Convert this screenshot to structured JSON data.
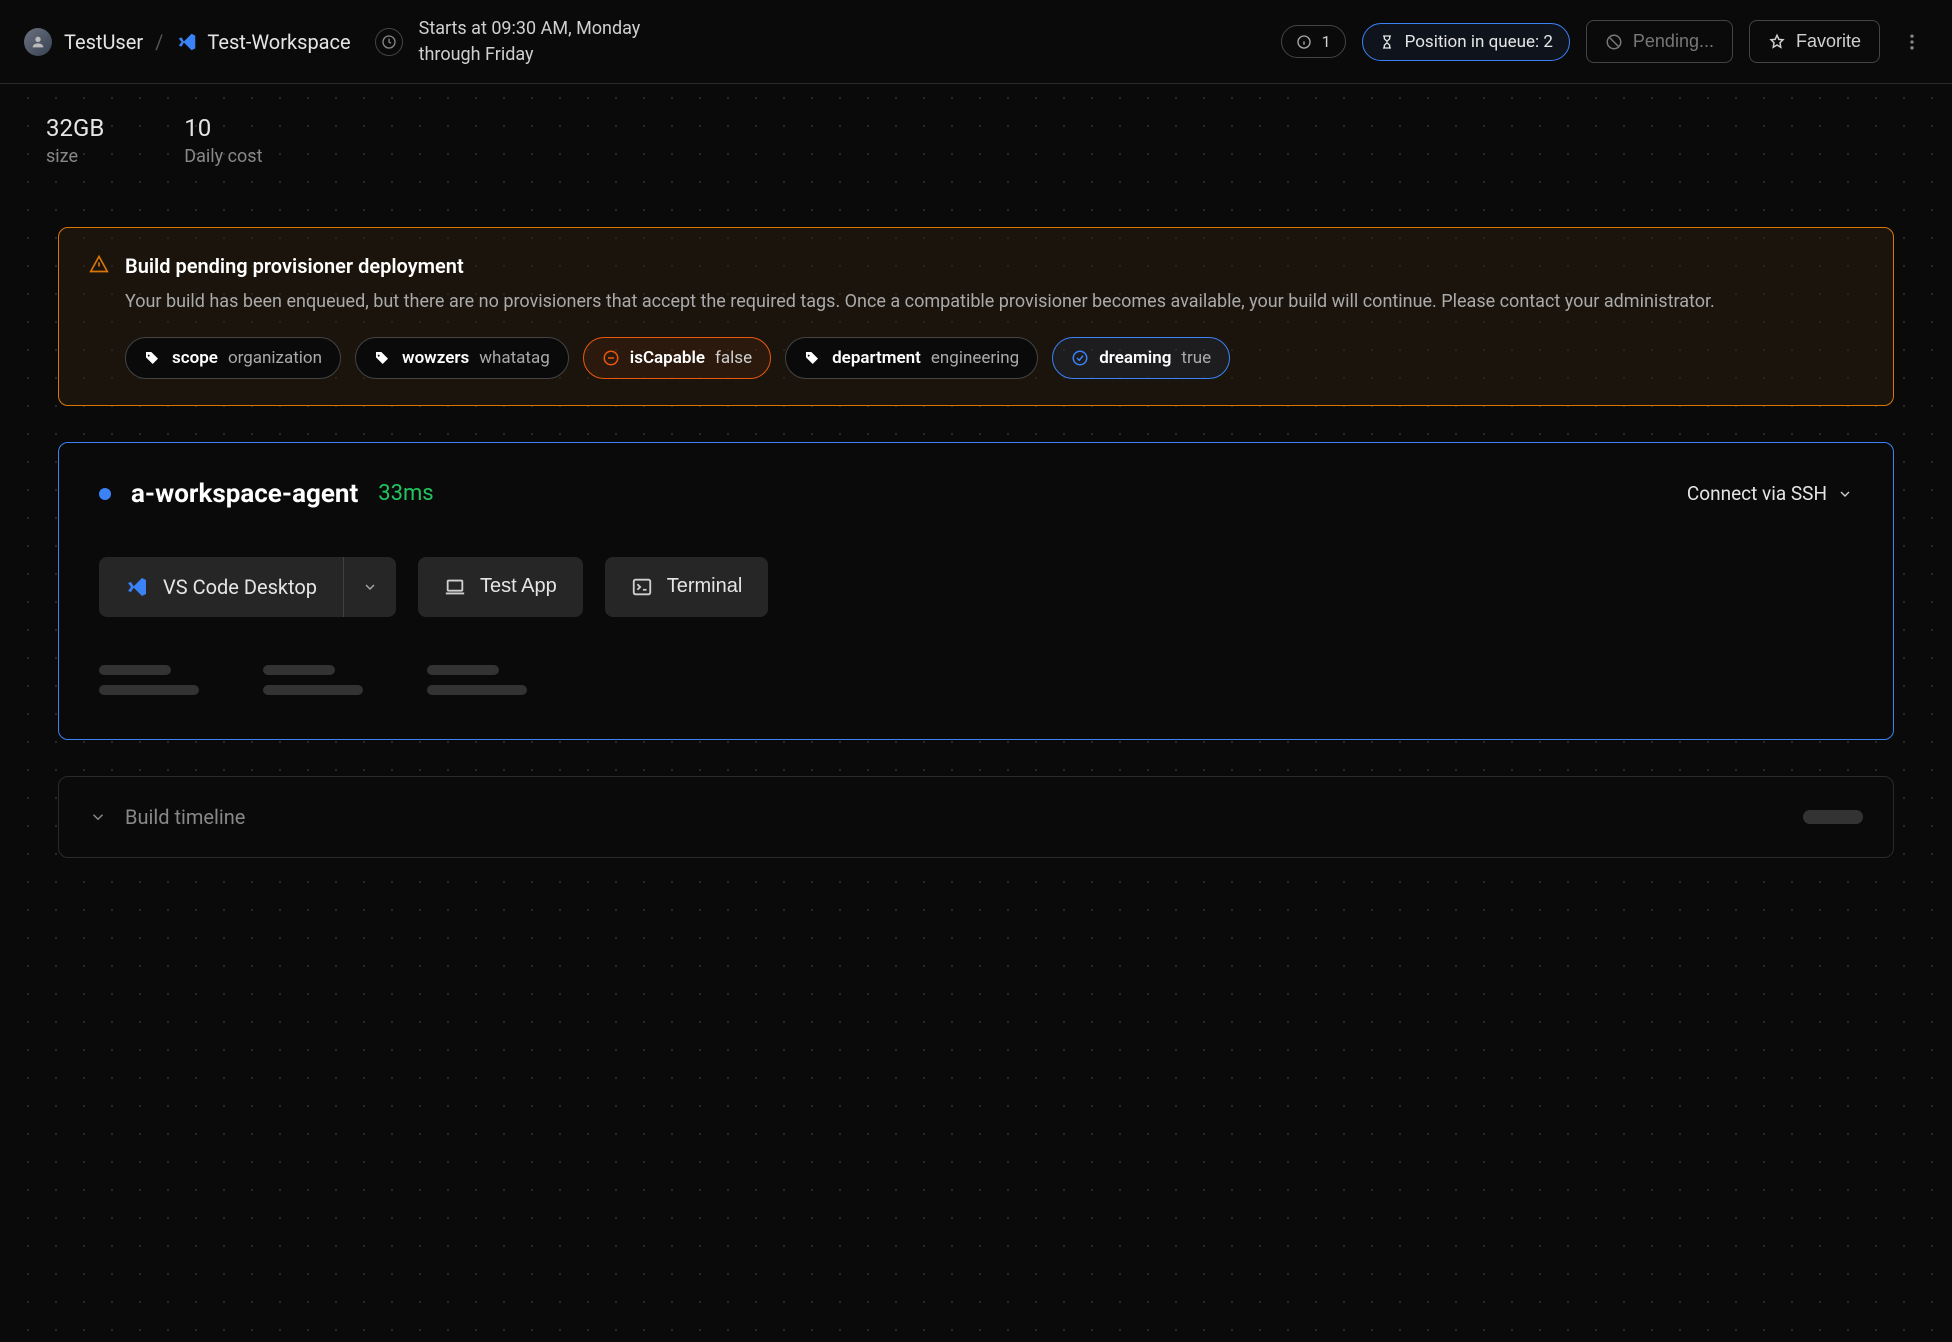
{
  "breadcrumb": {
    "user": "TestUser",
    "workspace": "Test-Workspace"
  },
  "schedule": "Starts at 09:30 AM, Monday through Friday",
  "header": {
    "info_count": "1",
    "queue_label": "Position in queue: 2",
    "pending_label": "Pending...",
    "favorite_label": "Favorite"
  },
  "stats": {
    "size_value": "32GB",
    "size_label": "size",
    "cost_value": "10",
    "cost_label": "Daily cost"
  },
  "alert": {
    "title": "Build pending provisioner deployment",
    "body": "Your build has been enqueued, but there are no provisioners that accept the required tags. Once a compatible provisioner becomes available, your build will continue. Please contact your administrator.",
    "tags": [
      {
        "key": "scope",
        "value": "organization",
        "variant": "default",
        "icon": "tag"
      },
      {
        "key": "wowzers",
        "value": "whatatag",
        "variant": "default",
        "icon": "tag"
      },
      {
        "key": "isCapable",
        "value": "false",
        "variant": "orange",
        "icon": "minus-circle"
      },
      {
        "key": "department",
        "value": "engineering",
        "variant": "default",
        "icon": "tag"
      },
      {
        "key": "dreaming",
        "value": "true",
        "variant": "blue",
        "icon": "check-circle"
      }
    ]
  },
  "agent": {
    "name": "a-workspace-agent",
    "latency": "33ms",
    "connect_label": "Connect via SSH",
    "apps": {
      "vscode": "VS Code Desktop",
      "test_app": "Test App",
      "terminal": "Terminal"
    }
  },
  "timeline": {
    "title": "Build timeline"
  }
}
